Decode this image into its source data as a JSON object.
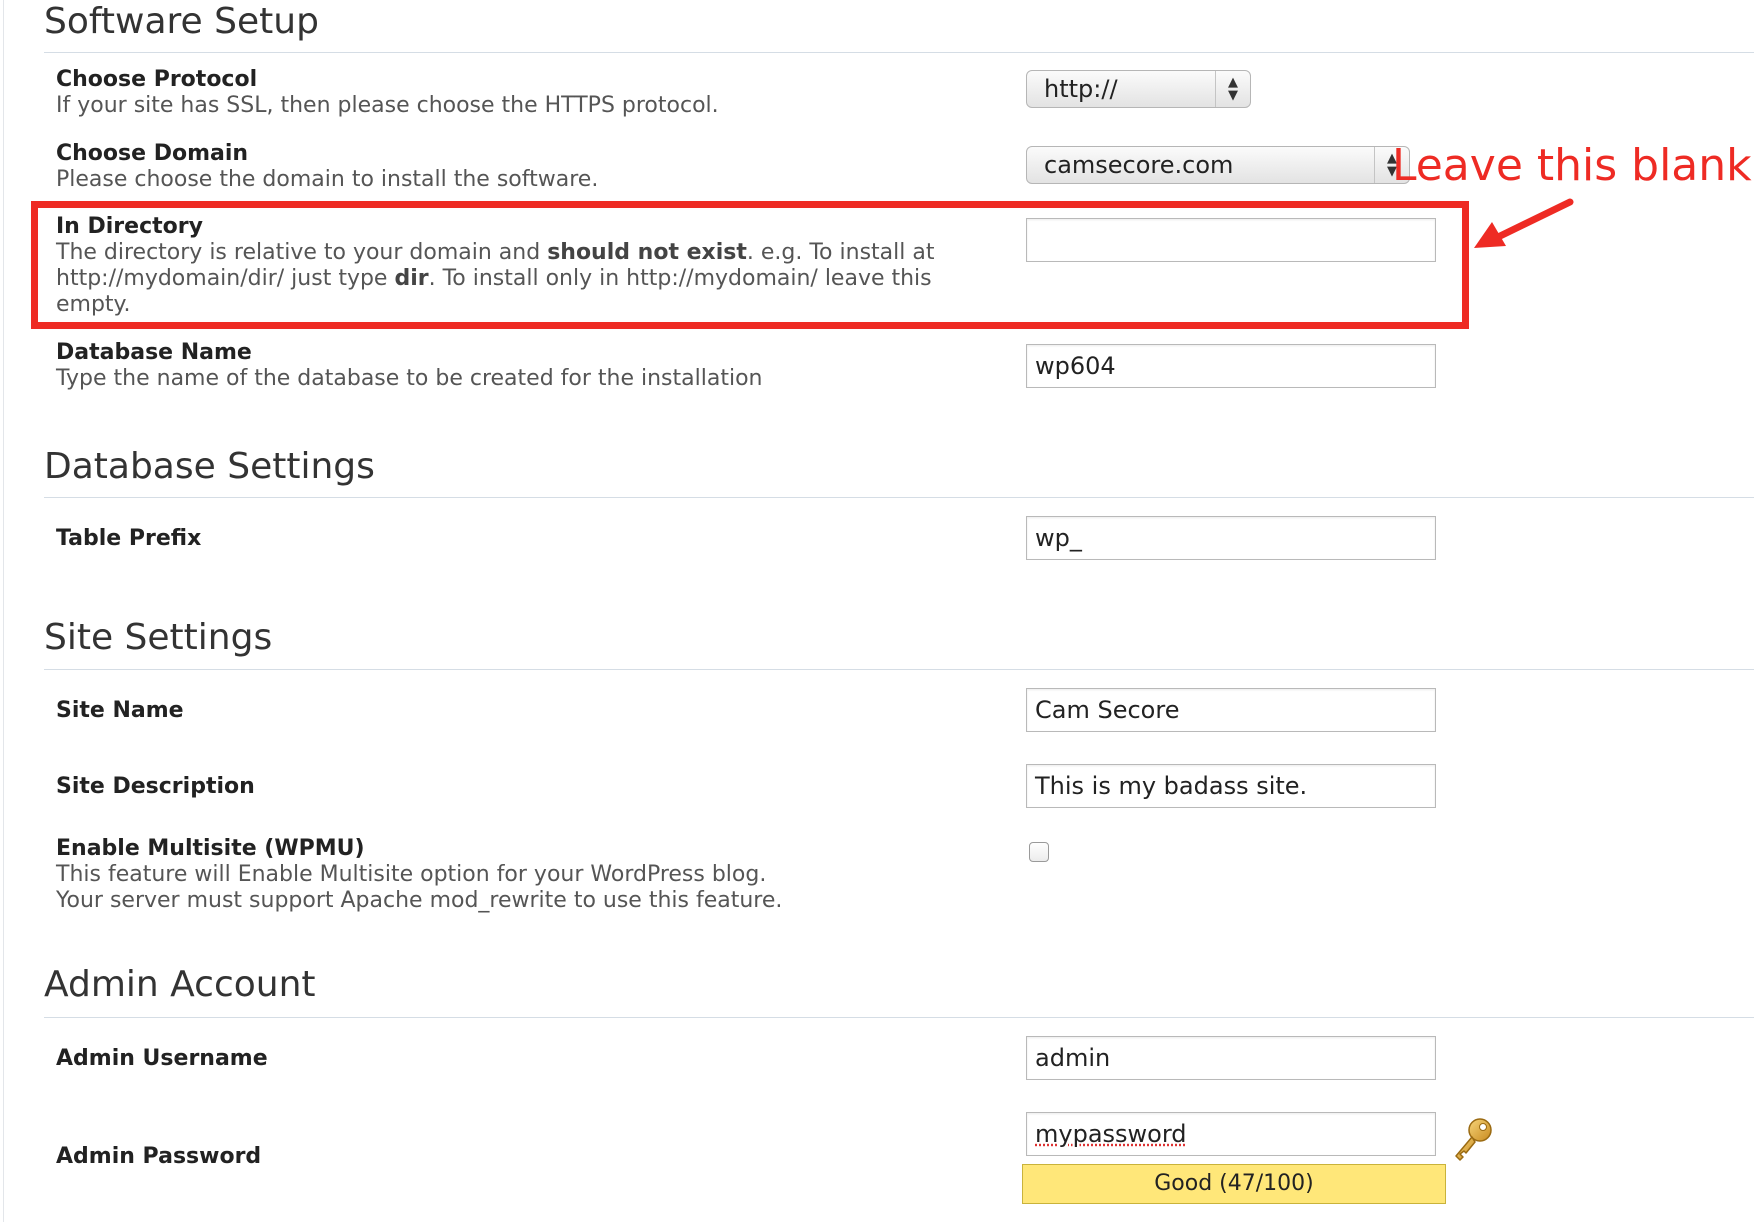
{
  "sections": {
    "software_setup": "Software Setup",
    "database_settings": "Database Settings",
    "site_settings": "Site Settings",
    "admin_account": "Admin Account"
  },
  "protocol": {
    "label": "Choose Protocol",
    "description": "If your site has SSL, then please choose the HTTPS protocol.",
    "selected": "http://"
  },
  "domain": {
    "label": "Choose Domain",
    "description": "Please choose the domain to install the software.",
    "selected": "camsecore.com"
  },
  "directory": {
    "label": "In Directory",
    "desc_1": "The directory is relative to your domain and ",
    "desc_2": "should not exist",
    "desc_3": ". e.g. To install at http://mydomain/dir/ just type ",
    "desc_4": "dir",
    "desc_5": ". To install only in http://mydomain/ leave this empty.",
    "value": ""
  },
  "database_name": {
    "label": "Database Name",
    "description": "Type the name of the database to be created for the installation",
    "value": "wp604"
  },
  "table_prefix": {
    "label": "Table Prefix",
    "value": "wp_"
  },
  "site_name": {
    "label": "Site Name",
    "value": "Cam Secore"
  },
  "site_description": {
    "label": "Site Description",
    "value": "This is my badass site."
  },
  "multisite": {
    "label": "Enable Multisite (WPMU)",
    "description_1": "This feature will Enable Multisite option for your WordPress blog.",
    "description_2": "Your server must support Apache mod_rewrite to use this feature.",
    "checked": false
  },
  "admin_username": {
    "label": "Admin Username",
    "value": "admin"
  },
  "admin_password": {
    "label": "Admin Password",
    "value": "mypassword",
    "strength": "Good (47/100)"
  },
  "annotation": {
    "text": "Leave this blank.",
    "color": "#ee2b24"
  }
}
